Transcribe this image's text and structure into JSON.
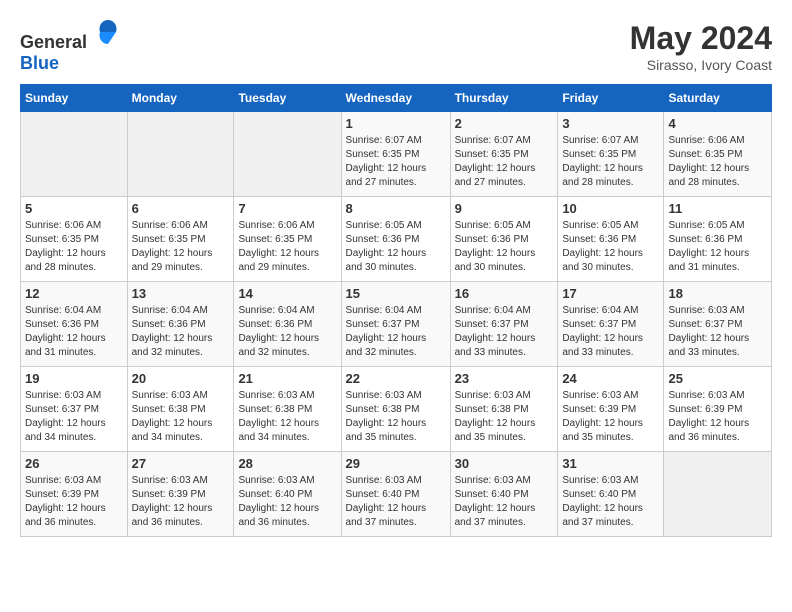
{
  "header": {
    "logo_general": "General",
    "logo_blue": "Blue",
    "month_year": "May 2024",
    "location": "Sirasso, Ivory Coast"
  },
  "days_of_week": [
    "Sunday",
    "Monday",
    "Tuesday",
    "Wednesday",
    "Thursday",
    "Friday",
    "Saturday"
  ],
  "weeks": [
    [
      {
        "day": "",
        "sunrise": "",
        "sunset": "",
        "daylight": "",
        "empty": true
      },
      {
        "day": "",
        "sunrise": "",
        "sunset": "",
        "daylight": "",
        "empty": true
      },
      {
        "day": "",
        "sunrise": "",
        "sunset": "",
        "daylight": "",
        "empty": true
      },
      {
        "day": "1",
        "sunrise": "Sunrise: 6:07 AM",
        "sunset": "Sunset: 6:35 PM",
        "daylight": "Daylight: 12 hours and 27 minutes.",
        "empty": false
      },
      {
        "day": "2",
        "sunrise": "Sunrise: 6:07 AM",
        "sunset": "Sunset: 6:35 PM",
        "daylight": "Daylight: 12 hours and 27 minutes.",
        "empty": false
      },
      {
        "day": "3",
        "sunrise": "Sunrise: 6:07 AM",
        "sunset": "Sunset: 6:35 PM",
        "daylight": "Daylight: 12 hours and 28 minutes.",
        "empty": false
      },
      {
        "day": "4",
        "sunrise": "Sunrise: 6:06 AM",
        "sunset": "Sunset: 6:35 PM",
        "daylight": "Daylight: 12 hours and 28 minutes.",
        "empty": false
      }
    ],
    [
      {
        "day": "5",
        "sunrise": "Sunrise: 6:06 AM",
        "sunset": "Sunset: 6:35 PM",
        "daylight": "Daylight: 12 hours and 28 minutes.",
        "empty": false
      },
      {
        "day": "6",
        "sunrise": "Sunrise: 6:06 AM",
        "sunset": "Sunset: 6:35 PM",
        "daylight": "Daylight: 12 hours and 29 minutes.",
        "empty": false
      },
      {
        "day": "7",
        "sunrise": "Sunrise: 6:06 AM",
        "sunset": "Sunset: 6:35 PM",
        "daylight": "Daylight: 12 hours and 29 minutes.",
        "empty": false
      },
      {
        "day": "8",
        "sunrise": "Sunrise: 6:05 AM",
        "sunset": "Sunset: 6:36 PM",
        "daylight": "Daylight: 12 hours and 30 minutes.",
        "empty": false
      },
      {
        "day": "9",
        "sunrise": "Sunrise: 6:05 AM",
        "sunset": "Sunset: 6:36 PM",
        "daylight": "Daylight: 12 hours and 30 minutes.",
        "empty": false
      },
      {
        "day": "10",
        "sunrise": "Sunrise: 6:05 AM",
        "sunset": "Sunset: 6:36 PM",
        "daylight": "Daylight: 12 hours and 30 minutes.",
        "empty": false
      },
      {
        "day": "11",
        "sunrise": "Sunrise: 6:05 AM",
        "sunset": "Sunset: 6:36 PM",
        "daylight": "Daylight: 12 hours and 31 minutes.",
        "empty": false
      }
    ],
    [
      {
        "day": "12",
        "sunrise": "Sunrise: 6:04 AM",
        "sunset": "Sunset: 6:36 PM",
        "daylight": "Daylight: 12 hours and 31 minutes.",
        "empty": false
      },
      {
        "day": "13",
        "sunrise": "Sunrise: 6:04 AM",
        "sunset": "Sunset: 6:36 PM",
        "daylight": "Daylight: 12 hours and 32 minutes.",
        "empty": false
      },
      {
        "day": "14",
        "sunrise": "Sunrise: 6:04 AM",
        "sunset": "Sunset: 6:36 PM",
        "daylight": "Daylight: 12 hours and 32 minutes.",
        "empty": false
      },
      {
        "day": "15",
        "sunrise": "Sunrise: 6:04 AM",
        "sunset": "Sunset: 6:37 PM",
        "daylight": "Daylight: 12 hours and 32 minutes.",
        "empty": false
      },
      {
        "day": "16",
        "sunrise": "Sunrise: 6:04 AM",
        "sunset": "Sunset: 6:37 PM",
        "daylight": "Daylight: 12 hours and 33 minutes.",
        "empty": false
      },
      {
        "day": "17",
        "sunrise": "Sunrise: 6:04 AM",
        "sunset": "Sunset: 6:37 PM",
        "daylight": "Daylight: 12 hours and 33 minutes.",
        "empty": false
      },
      {
        "day": "18",
        "sunrise": "Sunrise: 6:03 AM",
        "sunset": "Sunset: 6:37 PM",
        "daylight": "Daylight: 12 hours and 33 minutes.",
        "empty": false
      }
    ],
    [
      {
        "day": "19",
        "sunrise": "Sunrise: 6:03 AM",
        "sunset": "Sunset: 6:37 PM",
        "daylight": "Daylight: 12 hours and 34 minutes.",
        "empty": false
      },
      {
        "day": "20",
        "sunrise": "Sunrise: 6:03 AM",
        "sunset": "Sunset: 6:38 PM",
        "daylight": "Daylight: 12 hours and 34 minutes.",
        "empty": false
      },
      {
        "day": "21",
        "sunrise": "Sunrise: 6:03 AM",
        "sunset": "Sunset: 6:38 PM",
        "daylight": "Daylight: 12 hours and 34 minutes.",
        "empty": false
      },
      {
        "day": "22",
        "sunrise": "Sunrise: 6:03 AM",
        "sunset": "Sunset: 6:38 PM",
        "daylight": "Daylight: 12 hours and 35 minutes.",
        "empty": false
      },
      {
        "day": "23",
        "sunrise": "Sunrise: 6:03 AM",
        "sunset": "Sunset: 6:38 PM",
        "daylight": "Daylight: 12 hours and 35 minutes.",
        "empty": false
      },
      {
        "day": "24",
        "sunrise": "Sunrise: 6:03 AM",
        "sunset": "Sunset: 6:39 PM",
        "daylight": "Daylight: 12 hours and 35 minutes.",
        "empty": false
      },
      {
        "day": "25",
        "sunrise": "Sunrise: 6:03 AM",
        "sunset": "Sunset: 6:39 PM",
        "daylight": "Daylight: 12 hours and 36 minutes.",
        "empty": false
      }
    ],
    [
      {
        "day": "26",
        "sunrise": "Sunrise: 6:03 AM",
        "sunset": "Sunset: 6:39 PM",
        "daylight": "Daylight: 12 hours and 36 minutes.",
        "empty": false
      },
      {
        "day": "27",
        "sunrise": "Sunrise: 6:03 AM",
        "sunset": "Sunset: 6:39 PM",
        "daylight": "Daylight: 12 hours and 36 minutes.",
        "empty": false
      },
      {
        "day": "28",
        "sunrise": "Sunrise: 6:03 AM",
        "sunset": "Sunset: 6:40 PM",
        "daylight": "Daylight: 12 hours and 36 minutes.",
        "empty": false
      },
      {
        "day": "29",
        "sunrise": "Sunrise: 6:03 AM",
        "sunset": "Sunset: 6:40 PM",
        "daylight": "Daylight: 12 hours and 37 minutes.",
        "empty": false
      },
      {
        "day": "30",
        "sunrise": "Sunrise: 6:03 AM",
        "sunset": "Sunset: 6:40 PM",
        "daylight": "Daylight: 12 hours and 37 minutes.",
        "empty": false
      },
      {
        "day": "31",
        "sunrise": "Sunrise: 6:03 AM",
        "sunset": "Sunset: 6:40 PM",
        "daylight": "Daylight: 12 hours and 37 minutes.",
        "empty": false
      },
      {
        "day": "",
        "sunrise": "",
        "sunset": "",
        "daylight": "",
        "empty": true
      }
    ]
  ]
}
